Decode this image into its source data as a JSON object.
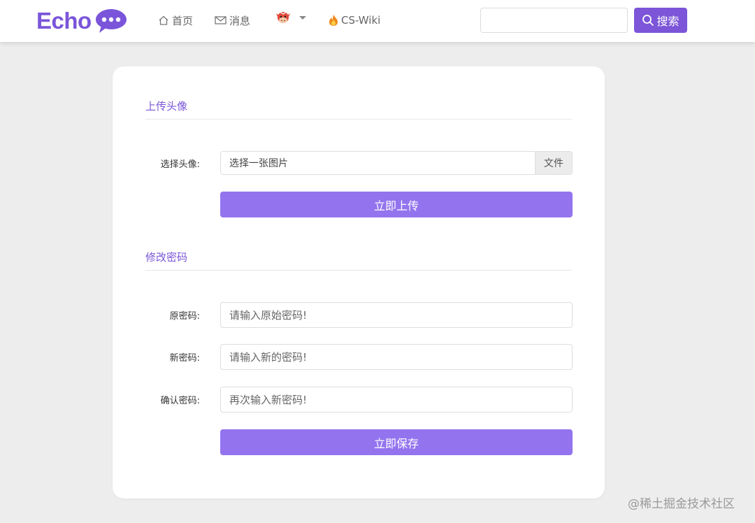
{
  "navbar": {
    "brand": "Echo",
    "home_label": "首页",
    "messages_label": "消息",
    "wiki_label": "CS-Wiki",
    "search_value": "",
    "search_button": "搜索",
    "accent_color": "#7c55d8"
  },
  "upload": {
    "section_title": "上传头像",
    "field_label": "选择头像:",
    "file_placeholder": "选择一张图片",
    "file_button": "文件",
    "submit_label": "立即上传"
  },
  "password": {
    "section_title": "修改密码",
    "old_label": "原密码:",
    "old_placeholder": "请输入原始密码!",
    "new_label": "新密码:",
    "new_placeholder": "请输入新的密码!",
    "confirm_label": "确认密码:",
    "confirm_placeholder": "再次输入新密码!",
    "submit_label": "立即保存",
    "button_color": "#9374ee"
  },
  "watermark": "@稀土掘金技术社区"
}
